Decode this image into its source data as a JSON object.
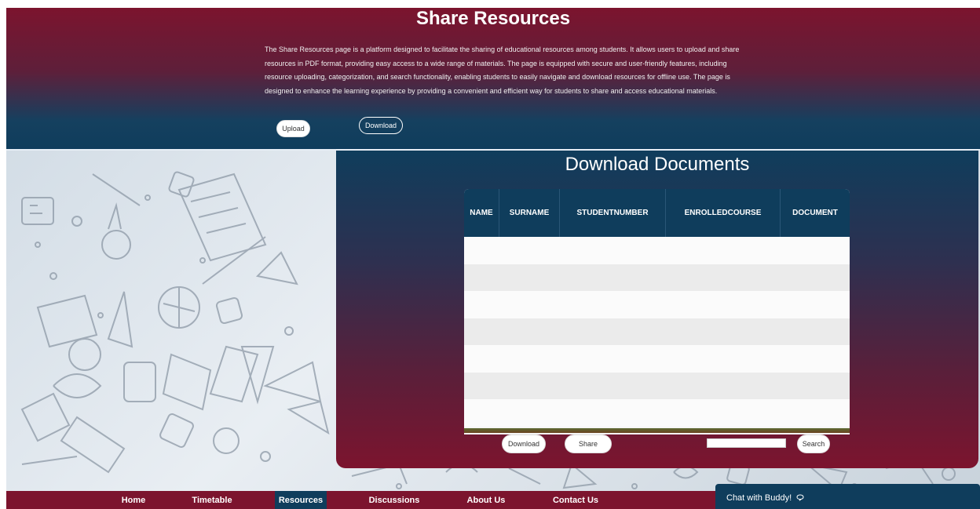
{
  "hero": {
    "title": "Share Resources",
    "description": "The Share Resources page is a platform designed to facilitate the sharing of educational resources among students. It allows users to upload and share resources in PDF format, providing easy access to a wide range of materials. The page is equipped with secure and user-friendly features, including resource uploading, categorization, and search functionality, enabling students to easily navigate and download resources for offline use. The page is designed to enhance the learning experience by providing a convenient and efficient way for students to share and access educational materials.",
    "upload_label": "Upload",
    "download_label": "Download"
  },
  "panel": {
    "title": "Download Documents",
    "columns": [
      "NAME",
      "SURNAME",
      "STUDENTNUMBER",
      "ENROLLEDCOURSE",
      "DOCUMENT"
    ],
    "download_label": "Download",
    "share_label": "Share",
    "search_value": "",
    "search_label": "Search"
  },
  "nav": {
    "home": "Home",
    "timetable": "Timetable",
    "resources": "Resources",
    "discussions": "Discussions",
    "about": "About Us",
    "contact": "Contact Us",
    "active": "Resources"
  },
  "chat": {
    "label": "Chat with Buddy!",
    "icon": "chat-bubble-icon"
  },
  "colors": {
    "brand_maroon": "#7c142e",
    "brand_navy": "#0f3d5c"
  }
}
